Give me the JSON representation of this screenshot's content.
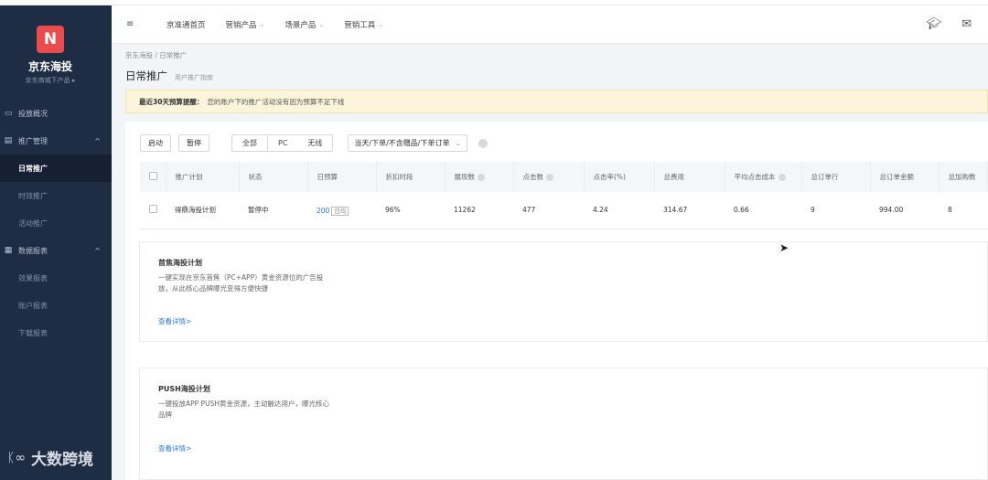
{
  "sidebar": {
    "logo_letter": "N",
    "brand_name": "京东海投",
    "brand_sub": "京东商城下产品 ▸",
    "nav": [
      {
        "label": "投放概况",
        "icon": "monitor-icon",
        "type": "item"
      },
      {
        "label": "推广管理",
        "icon": "briefcase-icon",
        "type": "group"
      },
      {
        "label": "日常推广",
        "type": "sub",
        "active": true
      },
      {
        "label": "时效推广",
        "type": "sub"
      },
      {
        "label": "活动推广",
        "type": "sub"
      },
      {
        "label": "数据报表",
        "icon": "report-icon",
        "type": "group"
      },
      {
        "label": "效果报表",
        "type": "sub"
      },
      {
        "label": "账户报表",
        "type": "sub"
      },
      {
        "label": "下载报表",
        "type": "sub"
      }
    ]
  },
  "watermark": {
    "mark": "ᛕ∞",
    "text": "大数跨境"
  },
  "topnav": {
    "hamburger": "≡",
    "items": [
      {
        "label": "京准通首页",
        "dropdown": false
      },
      {
        "label": "营销产品",
        "dropdown": true
      },
      {
        "label": "场景产品",
        "dropdown": true
      },
      {
        "label": "营销工具",
        "dropdown": true
      }
    ]
  },
  "breadcrumb": "京东海投 / 日常推广",
  "page": {
    "title": "日常推广",
    "subtitle": "用户推广指南"
  },
  "alert": {
    "strong": "最近30天预算提醒：",
    "text": "您的账户下的推广活动没有因为预算不足下线"
  },
  "toolbar": {
    "start": "启动",
    "pause": "暂停",
    "segments": [
      "全部",
      "PC",
      "无线"
    ],
    "select_value": "当天/下单/不含赠品/下单订单"
  },
  "table": {
    "headers": [
      "推广计划",
      "状态",
      "日预算",
      "折扣时段",
      "展现数",
      "点击数",
      "点击率(%)",
      "总费用",
      "平均点击成本",
      "总订单行",
      "总订单金额",
      "总加购数"
    ],
    "rows": [
      {
        "plan": "得鼎海投计划",
        "status": "暂停中",
        "budget": "200",
        "budget_tag": "日均",
        "discount": "96%",
        "impressions": "11262",
        "clicks": "477",
        "ctr": "4.24",
        "cost": "314.67",
        "cpc": "0.66",
        "orders": "9",
        "order_amount": "994.00",
        "cart_adds": "8"
      }
    ]
  },
  "promos": [
    {
      "title": "首焦海投计划",
      "desc": "一键实现在京东首焦（PC+APP）黄金资源位的广告投放，从此核心品牌曝光变得方便快捷",
      "link": "查看详情>"
    },
    {
      "title": "PUSH海投计划",
      "desc": "一键投放APP PUSH黄金资源，主动触达用户，曝光核心品牌",
      "link": "查看详情>"
    }
  ],
  "colors": {
    "sidebar_bg": "#1f2d44",
    "accent_red": "#e84c4c",
    "link_blue": "#2a78d4",
    "alert_bg": "#fdf4dc"
  }
}
